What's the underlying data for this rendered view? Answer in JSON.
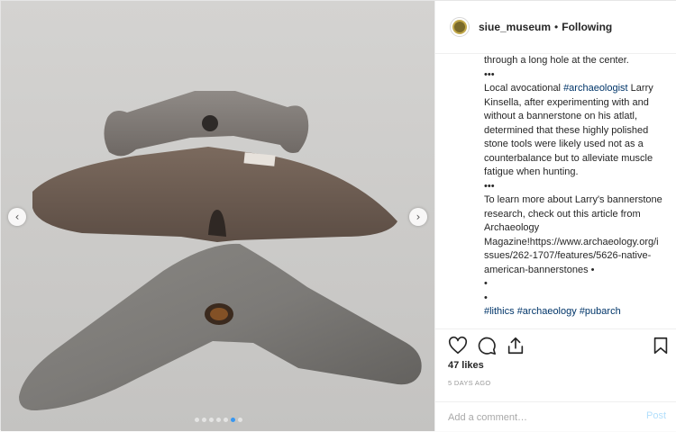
{
  "account": {
    "username": "siue_museum",
    "separator": "•",
    "follow_status": "Following"
  },
  "caption": {
    "lines": [
      "through a long hole at the center.",
      "•••",
      "Local avocational ",
      "archaeologist",
      " Larry Kinsella, after experimenting with and without a bannerstone on his atlatl, determined that these highly polished stone tools were likely used not as a counterbalance but to alleviate muscle fatigue when hunting.",
      "To learn more about Larry's bannerstone research, check out this article from Archaeology Magazine!https://www.archaeology.org/issues/262-1707/features/5626-native-american-bannerstones •",
      "•",
      "•",
      "#lithics #archaeology #pubarch"
    ],
    "tag_archaeologist": "#archaeologist",
    "intro_text": "through a long hole at the center.",
    "dots1": "•••",
    "dots2": "•••",
    "para1_before": "Local avocational ",
    "para1_after": " Larry Kinsella, after experimenting with and without a bannerstone on his atlatl, determined that these highly polished stone tools were likely used not as a counterbalance but to alleviate muscle fatigue when hunting.",
    "para2": "To learn more about Larry's bannerstone research, check out this article from Archaeology Magazine!https://www.archaeology.org/issues/262-1707/features/5626-native-american-bannerstones •",
    "bullet1": "•",
    "bullet2": "•",
    "hashtags": [
      "#lithics",
      "#archaeology",
      "#pubarch"
    ],
    "time_ago": "5d"
  },
  "engagement": {
    "likes": "47 likes",
    "posted": "5 DAYS AGO"
  },
  "comment": {
    "placeholder": "Add a comment…",
    "post_label": "Post"
  },
  "carousel": {
    "total_slides": 7,
    "active_slide": 6,
    "prev_arrow": "‹",
    "next_arrow": "›"
  },
  "colors": {
    "link": "#003569",
    "active_dot": "#3897f0",
    "post_disabled": "#b2dffc"
  },
  "icons": [
    "heart-icon",
    "comment-icon",
    "share-icon",
    "bookmark-icon"
  ]
}
